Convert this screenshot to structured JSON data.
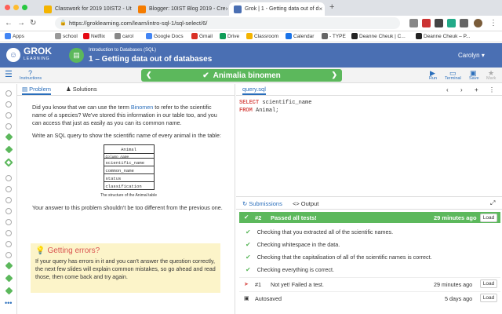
{
  "browser": {
    "tabs": [
      {
        "label": "Classwork for 2019 10IST2 - Ut",
        "color": "#f4b400"
      },
      {
        "label": "Blogger: 10IST Blog 2019 - Cre",
        "color": "#f57c00"
      },
      {
        "label": "Grok | 1 - Getting data out of d",
        "color": "#4a6fb3"
      }
    ],
    "new_tab": "+",
    "url": "https://groklearning.com/learn/intro-sql-1/sql-select/6/",
    "bookmarks": [
      "Apps",
      "school",
      "Netflix",
      "carol",
      "Google Docs",
      "Gmail",
      "Drive",
      "Classroom",
      "Calendar",
      "- TYPE",
      "Deanne Cheuk | C...",
      "Deanne Cheuk – P..."
    ]
  },
  "grok": {
    "logo_top": "GROK",
    "logo_bottom": "LEARNING",
    "course_subtitle": "Introduction to Databases (SQL)",
    "course_title": "1 – Getting data out of databases",
    "user": "Carolyn"
  },
  "toolbar": {
    "instructions": "Instructions",
    "slide_title": "Animalia binomen",
    "run": "Run",
    "terminal": "Terminal",
    "save": "Save",
    "mark": "Mark"
  },
  "left_panel": {
    "tab_problem": "Problem",
    "tab_solutions": "Solutions",
    "para1_a": "Did you know that we can use the term ",
    "para1_link": "Binomen",
    "para1_b": " to refer to the scientific name of a species? We've stored this information in our table too, and you can access that just as easily as you can its common name.",
    "para2": "Write an SQL query to show the scientific name of every animal in the table:",
    "table_name": "Animal",
    "table_colname": "Column_name",
    "table_cols": [
      "scientific_name",
      "common_name",
      "status",
      "classification"
    ],
    "caption": "The structure of the Animal table",
    "para3": "Your answer to this problem shouldn't be too different from the previous one.",
    "warn_title": "Getting errors?",
    "warn_body": "If your query has errors in it and you can't answer the question correctly, the next few slides will explain common mistakes, so go ahead and read those, then come back and try again."
  },
  "editor": {
    "file_tab": "query.sql",
    "line1_kw": "SELECT",
    "line1_rest": " scientific_name",
    "line2_kw": "FROM",
    "line2_rest": " Animal;"
  },
  "output": {
    "tab_submissions": "Submissions",
    "tab_output": "Output",
    "pass_num": "#2",
    "pass_text": "Passed all tests!",
    "pass_time": "29 minutes ago",
    "load": "Load",
    "checks": [
      "Checking that you extracted all of the scientific names.",
      "Checking whitespace in the data.",
      "Checking that the capitalisation of all of the scientific names is correct.",
      "Checking everything is correct."
    ],
    "fail_num": "#1",
    "fail_text": "Not yet! Failed a test.",
    "fail_time": "29 minutes ago",
    "autosaved": "Autosaved",
    "autosaved_time": "5 days ago"
  }
}
